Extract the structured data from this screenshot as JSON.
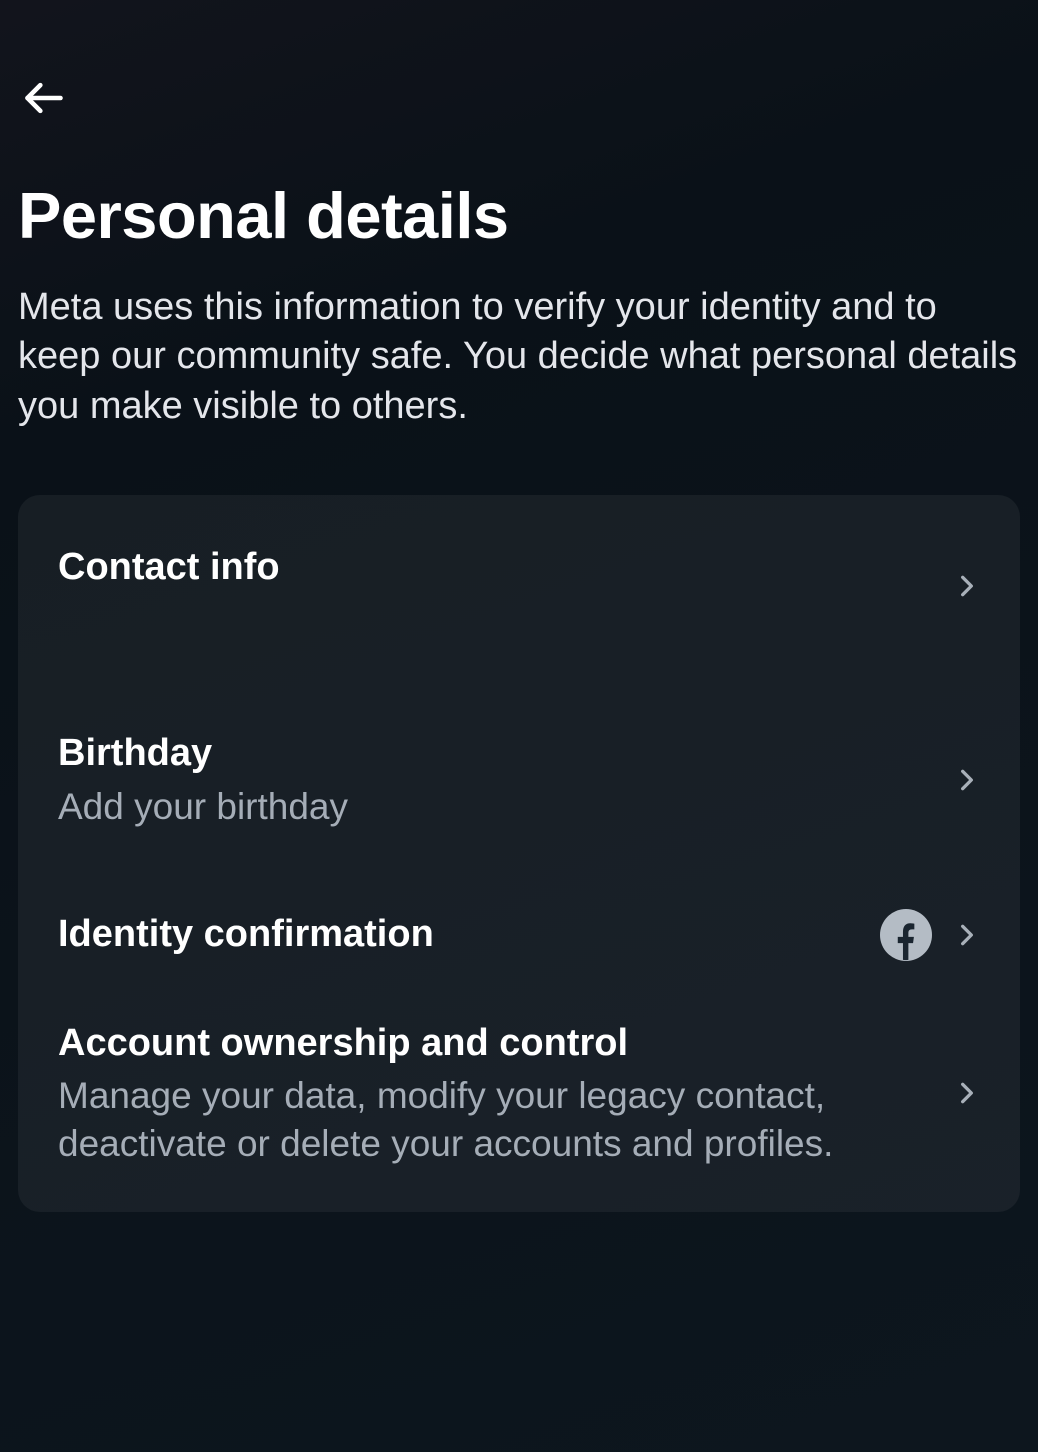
{
  "header": {
    "title": "Personal details",
    "description": "Meta uses this information to verify your identity and to keep our community safe. You decide what personal details you make visible to others."
  },
  "list": {
    "contact": {
      "title": "Contact info"
    },
    "birthday": {
      "title": "Birthday",
      "subtitle": "Add your birthday"
    },
    "identity": {
      "title": "Identity confirmation",
      "provider_icon": "facebook"
    },
    "ownership": {
      "title": "Account ownership and control",
      "subtitle": "Manage your data, modify your legacy contact, deactivate or delete your accounts and profiles."
    }
  }
}
